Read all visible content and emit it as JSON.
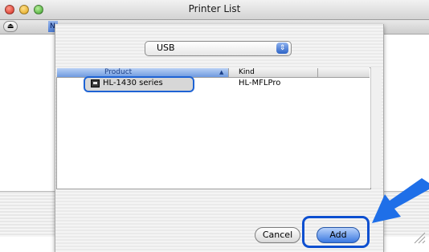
{
  "window": {
    "title": "Printer List"
  },
  "background": {
    "tab_label": "N"
  },
  "connection": {
    "selected": "USB"
  },
  "columns": {
    "product": "Product",
    "kind": "Kind"
  },
  "printers": [
    {
      "name": "HL-1430 series",
      "kind": "HL-MFLPro",
      "selected": true
    }
  ],
  "buttons": {
    "cancel": "Cancel",
    "add": "Add"
  },
  "colors": {
    "highlight_outline": "#0d4fd0",
    "arrow": "#1f6fe8",
    "selection": "#d7d7d7"
  },
  "icons": {
    "close": "close-light-icon",
    "minimize": "minimize-light-icon",
    "zoom": "zoom-light-icon",
    "printer": "printer-icon",
    "popup": "popup-arrows-icon"
  }
}
